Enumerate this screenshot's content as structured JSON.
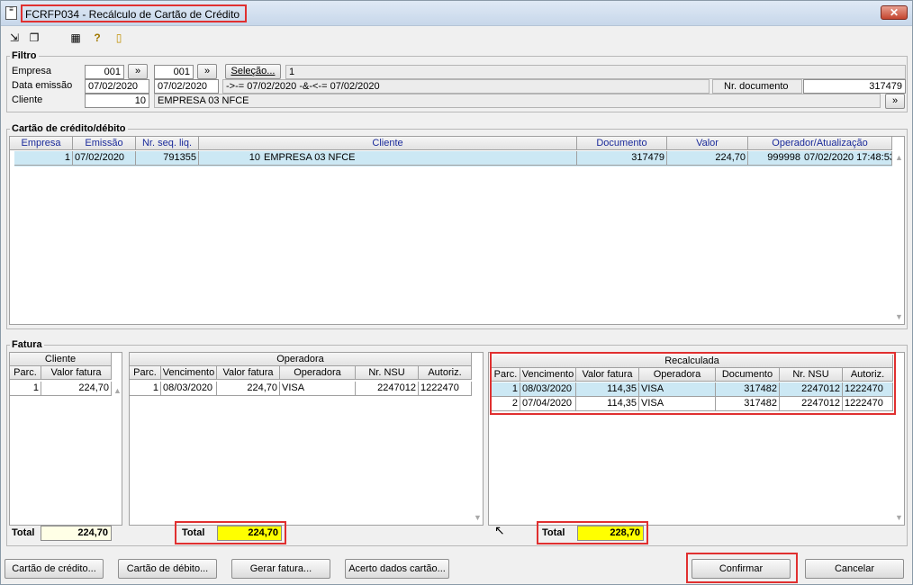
{
  "window": {
    "title": "FCRFP034 - Recálculo de Cartão de Crédito",
    "close_label": "✕"
  },
  "filtro": {
    "legend": "Filtro",
    "empresa_label": "Empresa",
    "empresa_from": "001",
    "empresa_to": "001",
    "jump_label": "»",
    "selecao_label": "Seleção...",
    "selecao_value": "1",
    "data_label": "Data emissão",
    "data_from": "07/02/2020",
    "data_to": "07/02/2020",
    "data_expr": "->-= 07/02/2020 -&-<-= 07/02/2020",
    "nrdoc_label": "Nr. documento",
    "nrdoc_value": "317479",
    "cliente_label": "Cliente",
    "cliente_code": "10",
    "cliente_name": "EMPRESA 03 NFCE"
  },
  "cartao": {
    "legend": "Cartão de crédito/débito",
    "headers": [
      "Empresa",
      "Emissão",
      "Nr. seq. liq.",
      "Cliente",
      "Documento",
      "Valor",
      "Operador/Atualização"
    ],
    "row": {
      "empresa": "1",
      "emissao": "07/02/2020",
      "seq": "791355",
      "cliente_code": "10",
      "cliente_name": "EMPRESA 03 NFCE",
      "documento": "317479",
      "valor": "224,70",
      "operador": "999998",
      "atualizacao": "07/02/2020 17:48:53"
    }
  },
  "fatura": {
    "legend": "Fatura",
    "cliente": {
      "title": "Cliente",
      "headers": [
        "Parc.",
        "Valor fatura"
      ],
      "rows": [
        {
          "parc": "1",
          "valor": "224,70"
        }
      ],
      "total_label": "Total",
      "total": "224,70"
    },
    "operadora": {
      "title": "Operadora",
      "headers": [
        "Parc.",
        "Vencimento",
        "Valor fatura",
        "Operadora",
        "Nr. NSU",
        "Autoriz."
      ],
      "rows": [
        {
          "parc": "1",
          "venc": "08/03/2020",
          "valor": "224,70",
          "operadora": "VISA",
          "nsu": "2247012",
          "autoriz": "1222470"
        }
      ],
      "total_label": "Total",
      "total": "224,70"
    },
    "recalculada": {
      "title": "Recalculada",
      "headers": [
        "Parc.",
        "Vencimento",
        "Valor fatura",
        "Operadora",
        "Documento",
        "Nr. NSU",
        "Autoriz."
      ],
      "rows": [
        {
          "parc": "1",
          "venc": "08/03/2020",
          "valor": "114,35",
          "operadora": "VISA",
          "documento": "317482",
          "nsu": "2247012",
          "autoriz": "1222470"
        },
        {
          "parc": "2",
          "venc": "07/04/2020",
          "valor": "114,35",
          "operadora": "VISA",
          "documento": "317482",
          "nsu": "2247012",
          "autoriz": "1222470"
        }
      ],
      "total_label": "Total",
      "total": "228,70"
    }
  },
  "buttons": {
    "cartao_credito": "Cartão de crédito...",
    "cartao_debito": "Cartão de débito...",
    "gerar_fatura": "Gerar fatura...",
    "acerto": "Acerto dados cartão...",
    "confirmar": "Confirmar",
    "cancelar": "Cancelar"
  },
  "colors": {
    "highlight": "#ffff00",
    "selection": "#cce8f4",
    "annotation": "#e03030"
  }
}
